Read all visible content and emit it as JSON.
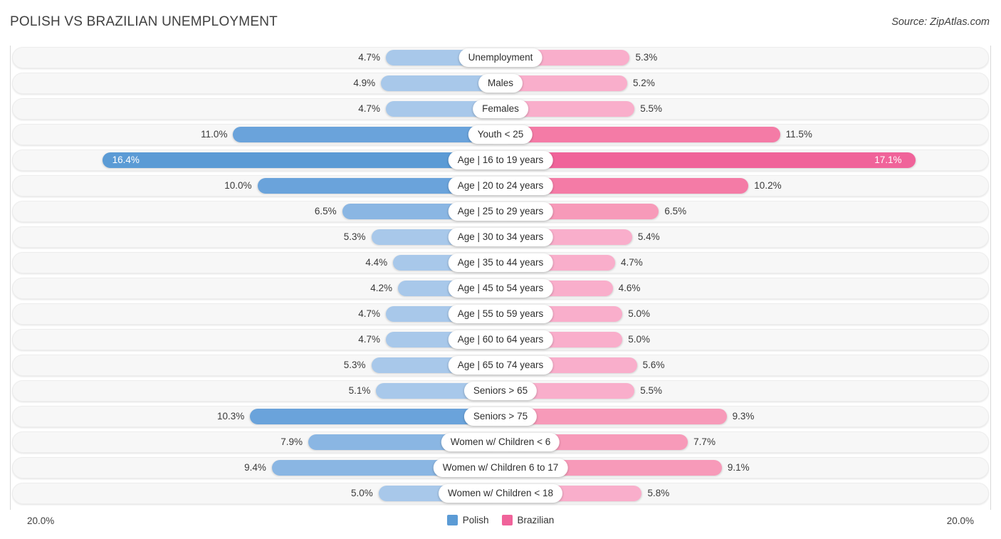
{
  "header": {
    "title": "POLISH VS BRAZILIAN UNEMPLOYMENT",
    "source": "Source: ZipAtlas.com"
  },
  "axis": {
    "left_max_label": "20.0%",
    "right_max_label": "20.0%"
  },
  "legend": {
    "items": [
      {
        "label": "Polish",
        "color": "#5b9bd5"
      },
      {
        "label": "Brazilian",
        "color": "#f0639a"
      }
    ]
  },
  "colors": {
    "polish_light": "#a8c8ea",
    "polish_mid": "#8ab6e3",
    "polish_strong": "#6aa3db",
    "polish_max": "#5b9bd5",
    "brazilian_light": "#f9aecb",
    "brazilian_mid": "#f79ab9",
    "brazilian_strong": "#f47ba6",
    "brazilian_max": "#f0639a",
    "track": "#f7f7f7",
    "pill": "#ffffff"
  },
  "chart_data": {
    "type": "bar",
    "subtype": "diverging-bar",
    "title": "POLISH VS BRAZILIAN UNEMPLOYMENT",
    "xlabel": "",
    "ylabel": "",
    "xlim": [
      0,
      20.0
    ],
    "unit": "%",
    "grid": false,
    "legend_position": "bottom-center",
    "categories": [
      "Unemployment",
      "Males",
      "Females",
      "Youth < 25",
      "Age | 16 to 19 years",
      "Age | 20 to 24 years",
      "Age | 25 to 29 years",
      "Age | 30 to 34 years",
      "Age | 35 to 44 years",
      "Age | 45 to 54 years",
      "Age | 55 to 59 years",
      "Age | 60 to 64 years",
      "Age | 65 to 74 years",
      "Seniors > 65",
      "Seniors > 75",
      "Women w/ Children < 6",
      "Women w/ Children 6 to 17",
      "Women w/ Children < 18"
    ],
    "series": [
      {
        "name": "Polish",
        "side": "left",
        "color": "#5b9bd5",
        "values": [
          4.7,
          4.9,
          4.7,
          11.0,
          16.4,
          10.0,
          6.5,
          5.3,
          4.4,
          4.2,
          4.7,
          4.7,
          5.3,
          5.1,
          10.3,
          7.9,
          9.4,
          5.0
        ],
        "labels": [
          "4.7%",
          "4.9%",
          "4.7%",
          "11.0%",
          "16.4%",
          "10.0%",
          "6.5%",
          "5.3%",
          "4.4%",
          "4.2%",
          "4.7%",
          "4.7%",
          "5.3%",
          "5.1%",
          "10.3%",
          "7.9%",
          "9.4%",
          "5.0%"
        ]
      },
      {
        "name": "Brazilian",
        "side": "right",
        "color": "#f0639a",
        "values": [
          5.3,
          5.2,
          5.5,
          11.5,
          17.1,
          10.2,
          6.5,
          5.4,
          4.7,
          4.6,
          5.0,
          5.0,
          5.6,
          5.5,
          9.3,
          7.7,
          9.1,
          5.8
        ],
        "labels": [
          "5.3%",
          "5.2%",
          "5.5%",
          "11.5%",
          "17.1%",
          "10.2%",
          "6.5%",
          "5.4%",
          "4.7%",
          "4.6%",
          "5.0%",
          "5.0%",
          "5.6%",
          "5.5%",
          "9.3%",
          "7.7%",
          "9.1%",
          "5.8%"
        ]
      }
    ]
  }
}
